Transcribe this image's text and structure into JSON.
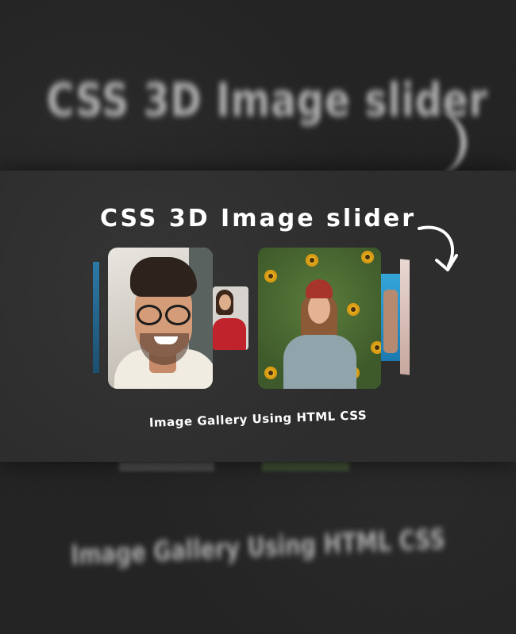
{
  "title": "CSS 3D Image slider",
  "subtitle": "Image Gallery Using HTML CSS",
  "background_title": "CSS 3D Image slider",
  "background_subtitle": "Image Gallery Using HTML CSS",
  "colors": {
    "background": "#232323",
    "card": "#2c2c2c",
    "text": "#ffffff"
  },
  "icons": [
    "curved-arrow-icon"
  ],
  "slides": [
    {
      "name": "blue-photo-slide"
    },
    {
      "name": "smiling-man-slide"
    },
    {
      "name": "woman-red-sweater-slide"
    },
    {
      "name": "woman-sunflower-slide"
    },
    {
      "name": "woman-blue-frame-slide"
    },
    {
      "name": "pink-photo-slide"
    }
  ]
}
